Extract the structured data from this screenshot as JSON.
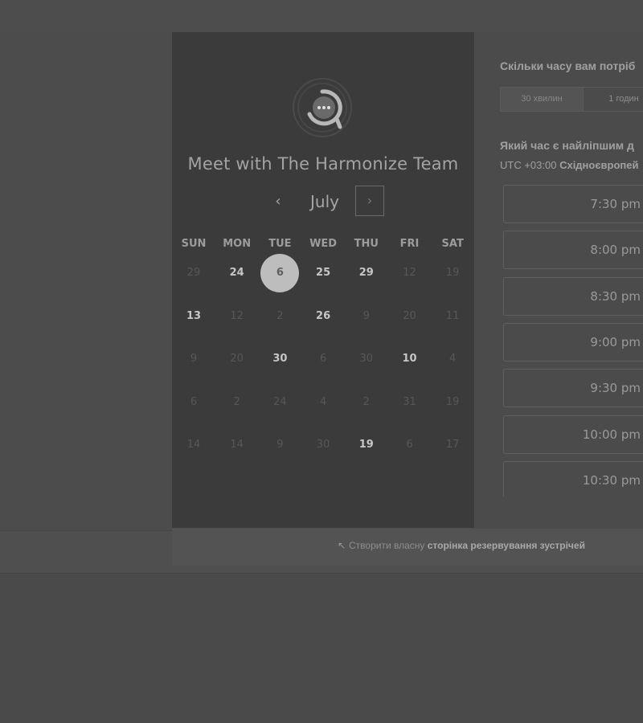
{
  "header": {},
  "booking": {
    "title": "Meet with The Harmonize Team",
    "month": "July",
    "prev_icon": "chevron-left-icon",
    "next_icon": "chevron-right-icon",
    "weekdays": [
      "SUN",
      "MON",
      "TUE",
      "WED",
      "THU",
      "FRI",
      "SAT"
    ],
    "weeks": [
      [
        {
          "d": "29",
          "a": false
        },
        {
          "d": "24",
          "a": true
        },
        {
          "d": "6",
          "a": true,
          "s": true
        },
        {
          "d": "25",
          "a": true
        },
        {
          "d": "29",
          "a": true
        },
        {
          "d": "12",
          "a": false
        },
        {
          "d": "19",
          "a": false
        }
      ],
      [
        {
          "d": "13",
          "a": true
        },
        {
          "d": "12",
          "a": false
        },
        {
          "d": "2",
          "a": false
        },
        {
          "d": "26",
          "a": true
        },
        {
          "d": "9",
          "a": false
        },
        {
          "d": "20",
          "a": false
        },
        {
          "d": "11",
          "a": false
        }
      ],
      [
        {
          "d": "9",
          "a": false
        },
        {
          "d": "20",
          "a": false
        },
        {
          "d": "30",
          "a": true
        },
        {
          "d": "6",
          "a": false
        },
        {
          "d": "30",
          "a": false
        },
        {
          "d": "10",
          "a": true
        },
        {
          "d": "4",
          "a": false
        }
      ],
      [
        {
          "d": "6",
          "a": false
        },
        {
          "d": "2",
          "a": false
        },
        {
          "d": "24",
          "a": false
        },
        {
          "d": "4",
          "a": false
        },
        {
          "d": "2",
          "a": false
        },
        {
          "d": "31",
          "a": false
        },
        {
          "d": "19",
          "a": false
        }
      ],
      [
        {
          "d": "14",
          "a": false
        },
        {
          "d": "14",
          "a": false
        },
        {
          "d": "9",
          "a": false
        },
        {
          "d": "30",
          "a": false
        },
        {
          "d": "19",
          "a": true
        },
        {
          "d": "6",
          "a": false
        },
        {
          "d": "17",
          "a": false
        }
      ]
    ]
  },
  "scheduler": {
    "duration_question": "Скільки часу вам потріб",
    "durations": [
      "30 хвилин",
      "1 годин"
    ],
    "time_question": "Який час є найліпшим д",
    "timezone_offset": "UTC +03:00",
    "timezone_name": "Східноєвропей",
    "slots": [
      "7:30 pm",
      "8:00 pm",
      "8:30 pm",
      "9:00 pm",
      "9:30 pm",
      "10:00 pm",
      "10:30 pm"
    ]
  },
  "footer": {
    "prefix": "Створити власну",
    "link": "сторінка резервування зустрічей"
  },
  "colors": {
    "panel": "#3b3b3b",
    "selected_day": "#bdbdbd",
    "background": "#4a4a4a"
  }
}
